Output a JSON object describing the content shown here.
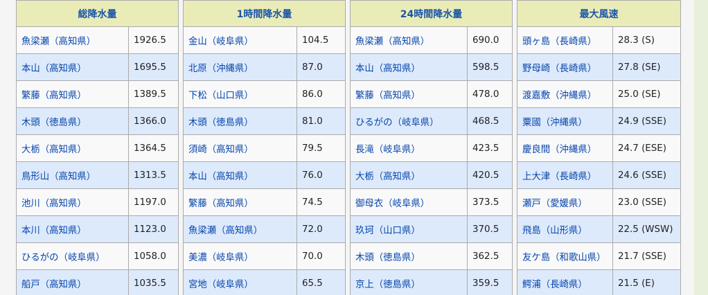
{
  "tables": [
    {
      "header": "総降水量",
      "rows": [
        {
          "loc": "魚梁瀬（高知県）",
          "val": "1926.5"
        },
        {
          "loc": "本山（高知県）",
          "val": "1695.5"
        },
        {
          "loc": "繁藤（高知県）",
          "val": "1389.5"
        },
        {
          "loc": "木頭（徳島県）",
          "val": "1366.0"
        },
        {
          "loc": "大栃（高知県）",
          "val": "1364.5"
        },
        {
          "loc": "鳥形山（高知県）",
          "val": "1313.5"
        },
        {
          "loc": "池川（高知県）",
          "val": "1197.0"
        },
        {
          "loc": "本川（高知県）",
          "val": "1123.0"
        },
        {
          "loc": "ひるがの（岐阜県）",
          "val": "1058.0"
        },
        {
          "loc": "船戸（高知県）",
          "val": "1035.5"
        }
      ]
    },
    {
      "header": "1時間降水量",
      "rows": [
        {
          "loc": "金山（岐阜県）",
          "val": "104.5"
        },
        {
          "loc": "北原（沖縄県）",
          "val": "87.0"
        },
        {
          "loc": "下松（山口県）",
          "val": "86.0"
        },
        {
          "loc": "木頭（徳島県）",
          "val": "81.0"
        },
        {
          "loc": "須崎（高知県）",
          "val": "79.5"
        },
        {
          "loc": "本山（高知県）",
          "val": "76.0"
        },
        {
          "loc": "繁藤（高知県）",
          "val": "74.5"
        },
        {
          "loc": "魚梁瀬（高知県）",
          "val": "72.0"
        },
        {
          "loc": "美濃（岐阜県）",
          "val": "70.0"
        },
        {
          "loc": "宮地（岐阜県）",
          "val": "65.5"
        }
      ]
    },
    {
      "header": "24時間降水量",
      "rows": [
        {
          "loc": "魚梁瀬（高知県）",
          "val": "690.0"
        },
        {
          "loc": "本山（高知県）",
          "val": "598.5"
        },
        {
          "loc": "繁藤（高知県）",
          "val": "478.0"
        },
        {
          "loc": "ひるがの（岐阜県）",
          "val": "468.5"
        },
        {
          "loc": "長滝（岐阜県）",
          "val": "423.5"
        },
        {
          "loc": "大栃（高知県）",
          "val": "420.5"
        },
        {
          "loc": "御母衣（岐阜県）",
          "val": "373.5"
        },
        {
          "loc": "玖珂（山口県）",
          "val": "370.5"
        },
        {
          "loc": "木頭（徳島県）",
          "val": "362.5"
        },
        {
          "loc": "京上（徳島県）",
          "val": "359.5"
        }
      ]
    },
    {
      "header": "最大風速",
      "rows": [
        {
          "loc": "頭ヶ島（長崎県）",
          "val": "28.3 (S)"
        },
        {
          "loc": "野母崎（長崎県）",
          "val": "27.8 (SE)"
        },
        {
          "loc": "渡嘉敷（沖縄県）",
          "val": "25.0 (SE)"
        },
        {
          "loc": "粟國（沖縄県）",
          "val": "24.9 (SSE)"
        },
        {
          "loc": "慶良間（沖縄県）",
          "val": "24.7 (ESE)"
        },
        {
          "loc": "上大津（長崎県）",
          "val": "24.6 (SSE)"
        },
        {
          "loc": "瀬戸（愛媛県）",
          "val": "23.0 (SSE)"
        },
        {
          "loc": "飛島（山形県）",
          "val": "22.5 (WSW)"
        },
        {
          "loc": "友ケ島（和歌山県）",
          "val": "21.7 (SSE)"
        },
        {
          "loc": "鰐浦（長崎県）",
          "val": "21.5 (E)"
        }
      ]
    }
  ]
}
